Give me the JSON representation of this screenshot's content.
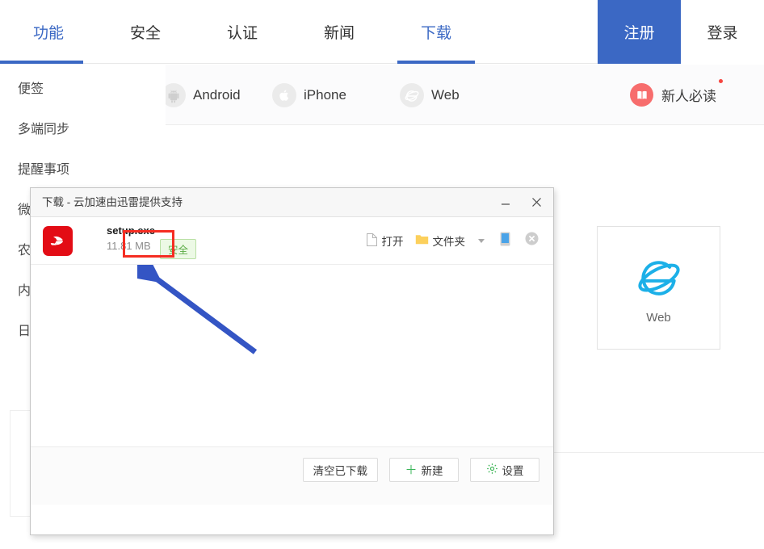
{
  "topnav": {
    "items": [
      {
        "label": "功能",
        "active": true
      },
      {
        "label": "安全",
        "active": false
      },
      {
        "label": "认证",
        "active": false
      },
      {
        "label": "新闻",
        "active": false
      },
      {
        "label": "下载",
        "active": true
      }
    ],
    "register_label": "注册",
    "login_label": "登录",
    "accent_color": "#3b68c4"
  },
  "platform_tabs": {
    "android": {
      "label": "Android",
      "icon": "android-icon"
    },
    "iphone": {
      "label": "iPhone",
      "icon": "apple-icon"
    },
    "web": {
      "label": "Web",
      "icon": "ie-icon"
    },
    "newbie": {
      "label": "新人必读",
      "icon": "book-icon",
      "badge_color": "#f6453f"
    }
  },
  "sidebar": {
    "items": [
      {
        "label": "便签"
      },
      {
        "label": "多端同步"
      },
      {
        "label": "提醒事项"
      },
      {
        "label": "微"
      },
      {
        "label": "农"
      },
      {
        "label": "内"
      },
      {
        "label": "日"
      }
    ]
  },
  "content": {
    "web_card": {
      "label": "Web",
      "icon": "ie-icon",
      "icon_color": "#1cb0e8"
    }
  },
  "dialog": {
    "title": "下载 - 云加速由迅雷提供支持",
    "minimize_icon": "minimize-icon",
    "close_icon": "close-icon",
    "download_item": {
      "file_name": "setup.exe",
      "file_size": "11.81 MB",
      "safe_label": "安全",
      "safe_text_color": "#5aab44",
      "safe_bg_color": "#ecf9e5",
      "icon": "xunlei-icon",
      "icon_color": "#e30c15",
      "actions": {
        "open_label": "打开",
        "open_icon": "file-icon",
        "folder_label": "文件夹",
        "folder_icon": "folder-icon",
        "dropdown_icon": "chevron-down-icon",
        "phone_icon": "phone-icon",
        "delete_icon": "remove-circle-icon"
      }
    },
    "footer": {
      "clear_label": "清空已下载",
      "new_label": "新建",
      "new_icon": "plus-icon",
      "settings_label": "设置",
      "settings_icon": "gear-icon"
    }
  },
  "annotation": {
    "highlight_color": "#f52d22",
    "arrow_color": "#3455c4",
    "target": "安全"
  }
}
